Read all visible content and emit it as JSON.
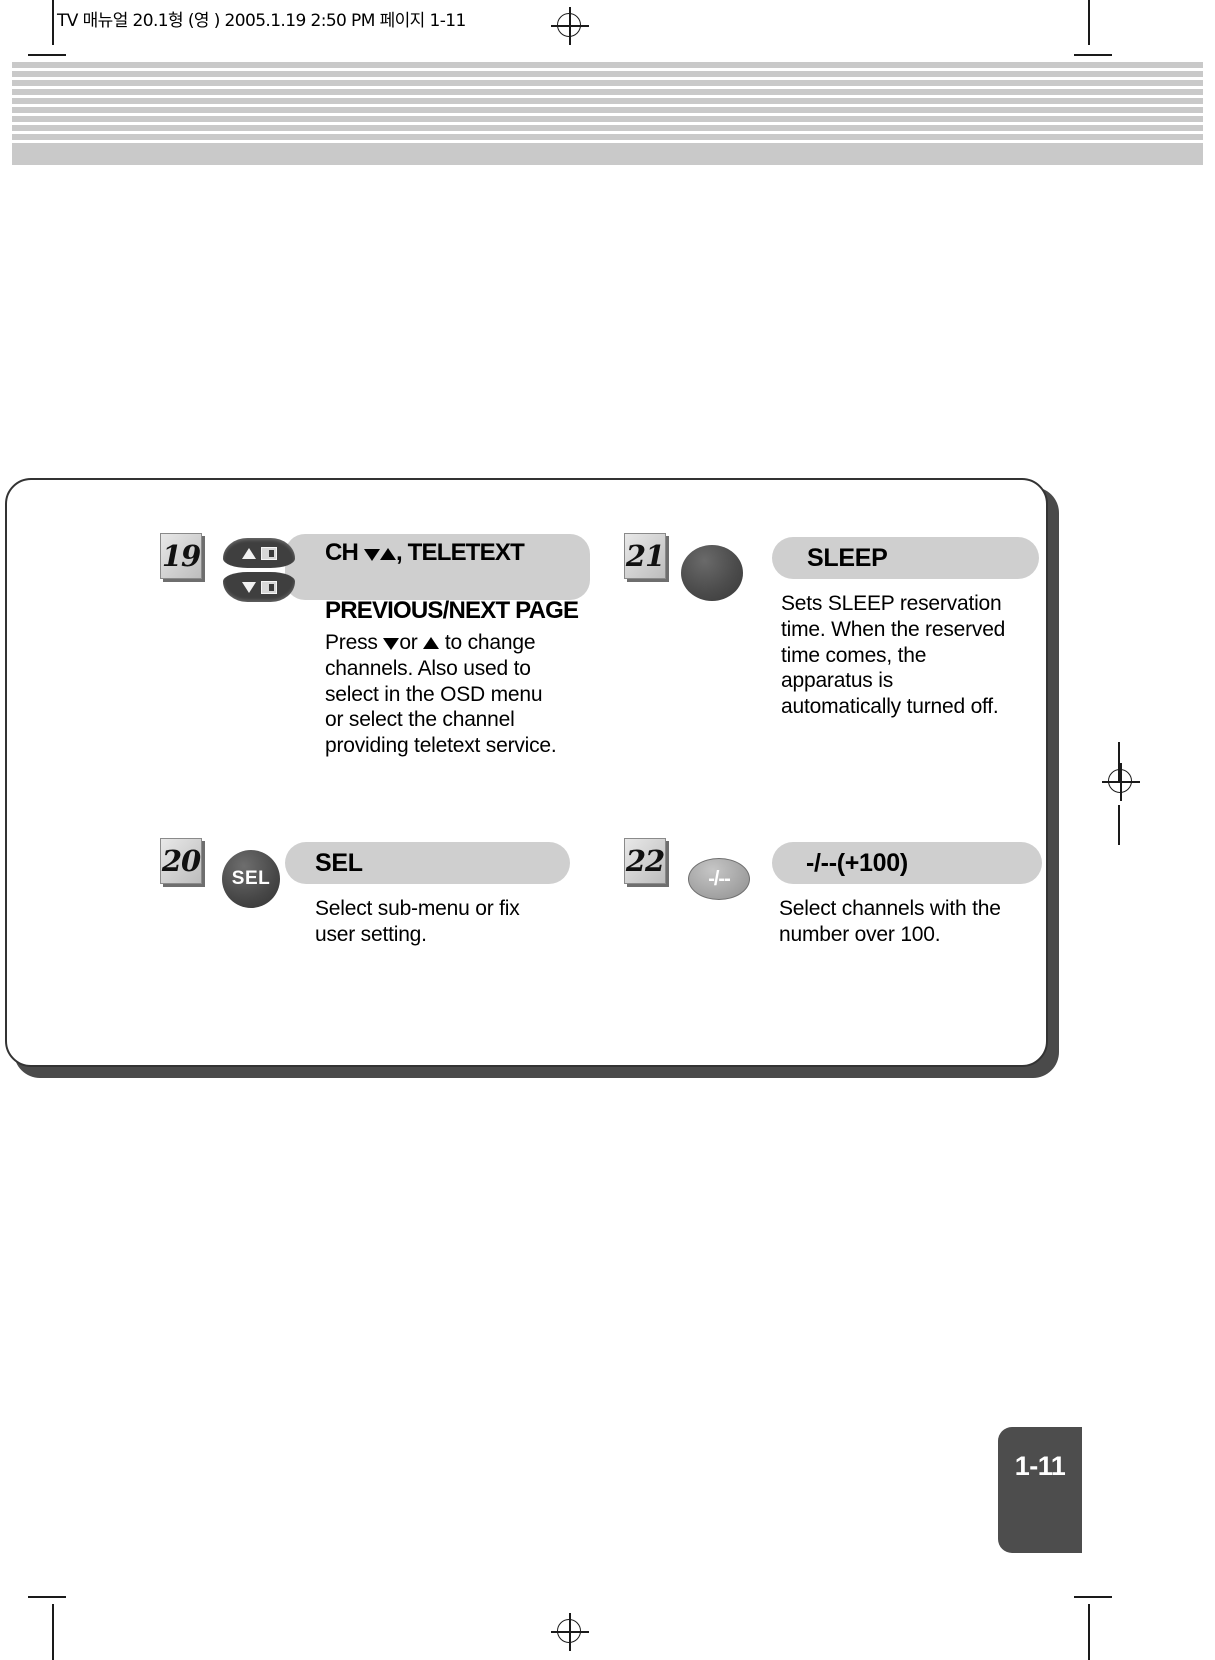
{
  "document": {
    "filestamp": "TV 매뉴얼 20.1형 (영 )  2005.1.19 2:50 PM  페이지 1-11",
    "page_number": "1-11"
  },
  "entries": [
    {
      "number": "19",
      "title": "CH ▼▲, TELETEXT\nPREVIOUS/NEXT PAGE",
      "title_line1_prefix": "CH ",
      "title_line1_suffix": ", TELETEXT",
      "title_line2": "PREVIOUS/NEXT PAGE",
      "button_icon": "channel-rocker-icon",
      "body_prefix": "Press ",
      "body_mid": "or ",
      "body_suffix": " to change channels. Also used to select in the OSD menu or select the channel providing teletext service."
    },
    {
      "number": "21",
      "title": "SLEEP",
      "button_icon": "sleep-round-button-icon",
      "body": "Sets SLEEP reservation time. When the reserved time comes, the apparatus is automatically turned off."
    },
    {
      "number": "20",
      "title": "SEL",
      "button_icon": "sel-round-button-icon",
      "button_label": "SEL",
      "body": "Select sub-menu or fix user setting."
    },
    {
      "number": "22",
      "title": "-/--(+100)",
      "button_icon": "dash-slash-oval-button-icon",
      "button_label": "-/--",
      "body": "Select channels with the number over 100."
    }
  ]
}
